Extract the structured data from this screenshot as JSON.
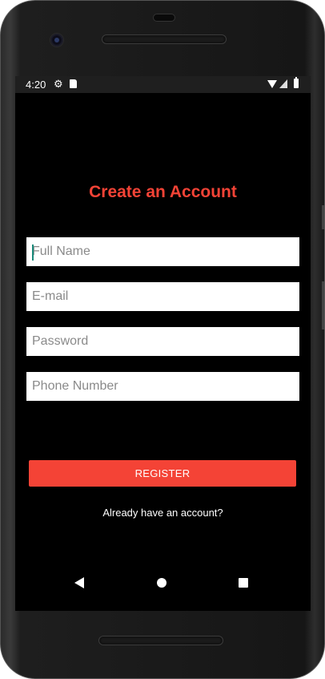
{
  "status_bar": {
    "time": "4:20",
    "icons": [
      "settings-icon",
      "sd-card-icon",
      "wifi-icon",
      "signal-icon",
      "battery-icon"
    ]
  },
  "form": {
    "title": "Create an Account",
    "fields": {
      "full_name": {
        "placeholder": "Full Name",
        "value": ""
      },
      "email": {
        "placeholder": "E-mail",
        "value": ""
      },
      "password": {
        "placeholder": "Password",
        "value": ""
      },
      "phone": {
        "placeholder": "Phone Number",
        "value": ""
      }
    },
    "register_label": "REGISTER",
    "login_link": "Already have an account?"
  },
  "nav_bar": {
    "icons": [
      "back-icon",
      "home-icon",
      "recents-icon"
    ]
  },
  "colors": {
    "accent": "#f44336",
    "background": "#000000",
    "field_background": "#ffffff",
    "text_light": "#ffffff",
    "placeholder": "#8a8a8a"
  }
}
